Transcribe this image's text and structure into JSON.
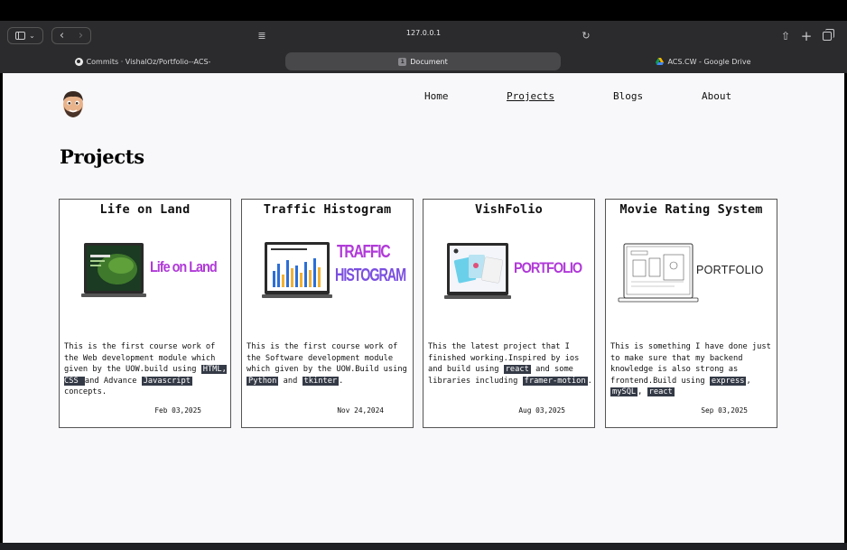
{
  "browser": {
    "url": "127.0.0.1",
    "tabs": [
      {
        "label": "Commits · VishalOz/Portfolio--ACS-",
        "icon": "github-icon"
      },
      {
        "label": "Document",
        "badge": "1",
        "active": true
      },
      {
        "label": "ACS.CW - Google Drive",
        "icon": "google-drive-icon"
      }
    ]
  },
  "nav": {
    "items": [
      "Home",
      "Projects",
      "Blogs",
      "About"
    ],
    "active": "Projects"
  },
  "page": {
    "title": "Projects"
  },
  "projects": [
    {
      "title": "Life on Land",
      "image_text": "Life on Land",
      "desc_parts": [
        "This is the first course work of the Web development module which given by the UOW.build using ",
        "HTML, CSS ",
        " and Advance ",
        "Javascript",
        " concepts."
      ],
      "date": "Feb 03,2025"
    },
    {
      "title": "Traffic Histogram",
      "image_text_1": "TRAFFIC",
      "image_text_2": "HISTOGRAM",
      "desc_parts": [
        "This is the first course work of the Software development module which given by the UOW.Build using ",
        "Python",
        " and ",
        "tkinter",
        "."
      ],
      "date": "Nov 24,2024"
    },
    {
      "title": "VishFolio",
      "image_text": "PORTFOLIO",
      "desc_parts": [
        "This the latest project that I finished working.Inspired by ios and build using ",
        "react",
        " and some libraries including ",
        "framer-motion",
        "."
      ],
      "date": "Aug 03,2025"
    },
    {
      "title": "Movie Rating System",
      "image_text": "PORTFOLIO",
      "desc_parts": [
        "This is something I have done just to make sure that my backend knowledge is also strong as frontend.Build using ",
        "express",
        ", ",
        "mySQL",
        ", ",
        "react"
      ],
      "date": "Sep 03,2025"
    }
  ],
  "colors": {
    "tag_bg": "#343a46",
    "page_bg": "#f8f8fa",
    "chrome_bg": "#2b2b2d"
  }
}
